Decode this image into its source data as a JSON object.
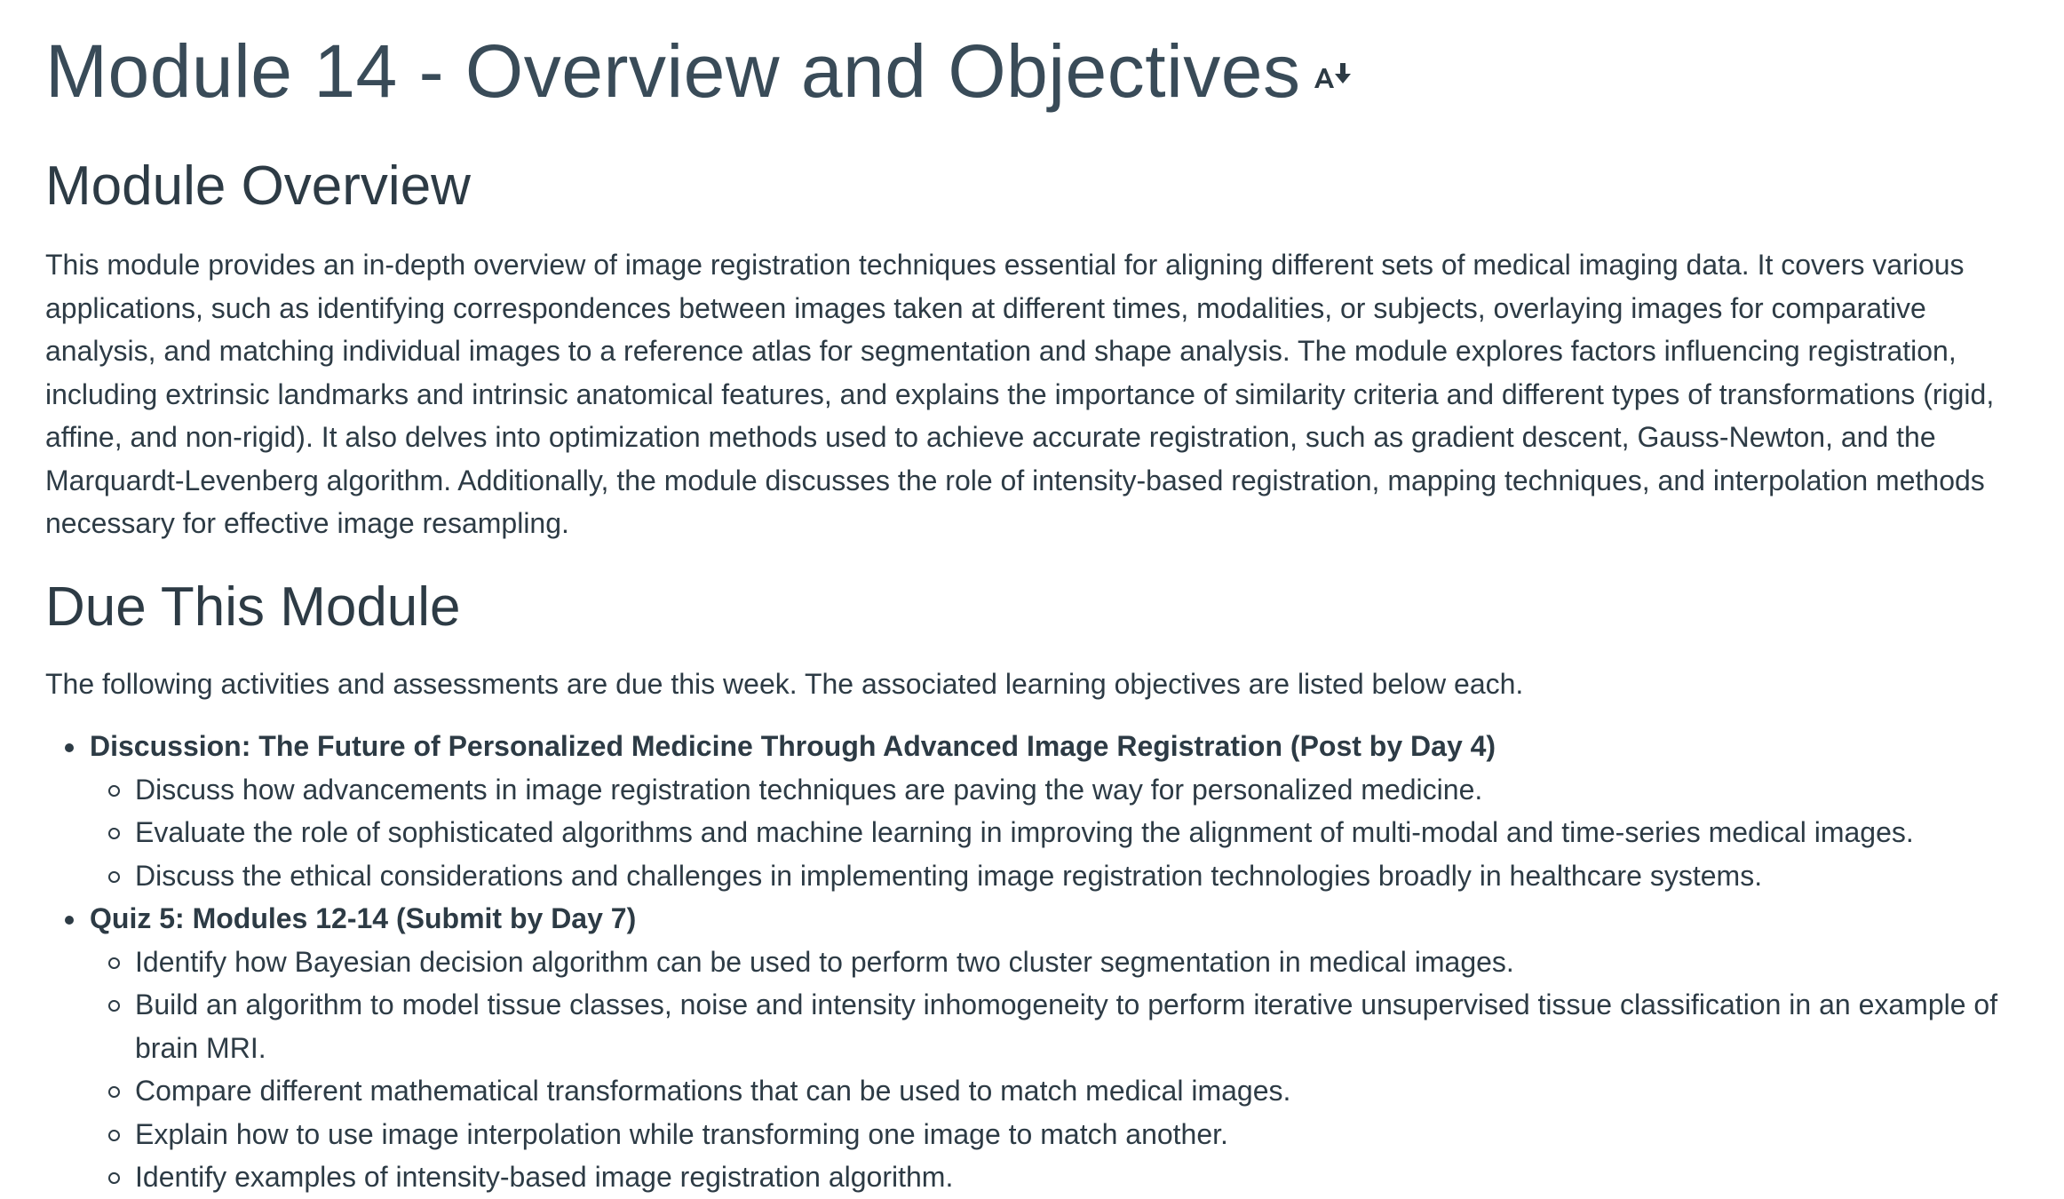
{
  "header": {
    "title": "Module 14 - Overview and Objectives",
    "sort_icon": "sort-alpha-down-icon"
  },
  "overview": {
    "heading": "Module Overview",
    "text": "This module provides an in-depth overview of image registration techniques essential for aligning different sets of medical imaging data. It covers various applications, such as identifying correspondences between images taken at different times, modalities, or subjects, overlaying images for comparative analysis, and matching individual images to a reference atlas for segmentation and shape analysis. The module explores factors influencing registration, including extrinsic landmarks and intrinsic anatomical features, and explains the importance of similarity criteria and different types of transformations (rigid, affine, and non-rigid). It also delves into optimization methods used to achieve accurate registration, such as gradient descent, Gauss-Newton, and the Marquardt-Levenberg algorithm. Additionally, the module discusses the role of intensity-based registration, mapping techniques, and interpolation methods necessary for effective image resampling."
  },
  "due": {
    "heading": "Due This Module",
    "intro": "The following activities and assessments are due this week. The associated learning objectives are listed below each.",
    "activities": [
      {
        "title": "Discussion: The Future of Personalized Medicine Through Advanced Image Registration (Post by Day 4)",
        "objectives": [
          "Discuss how advancements in image registration techniques are paving the way for personalized medicine.",
          "Evaluate the role of sophisticated algorithms and machine learning in improving the alignment of multi-modal and time-series medical images.",
          "Discuss the ethical considerations and challenges in implementing image registration technologies broadly in healthcare systems."
        ]
      },
      {
        "title": "Quiz 5: Modules 12-14 (Submit by Day 7)",
        "objectives": [
          "Identify how Bayesian decision algorithm can be used to perform two cluster segmentation in medical images.",
          "Build an algorithm to model tissue classes, noise and intensity inhomogeneity to perform iterative unsupervised tissue classification in an example of brain MRI.",
          "Compare different mathematical transformations that can be used to match medical images.",
          "Explain how to use image interpolation while transforming one image to match another.",
          "Identify examples of intensity-based image registration algorithm."
        ]
      }
    ]
  },
  "colors": {
    "text": "#2d3b45",
    "title": "#394b58",
    "background": "#ffffff"
  }
}
